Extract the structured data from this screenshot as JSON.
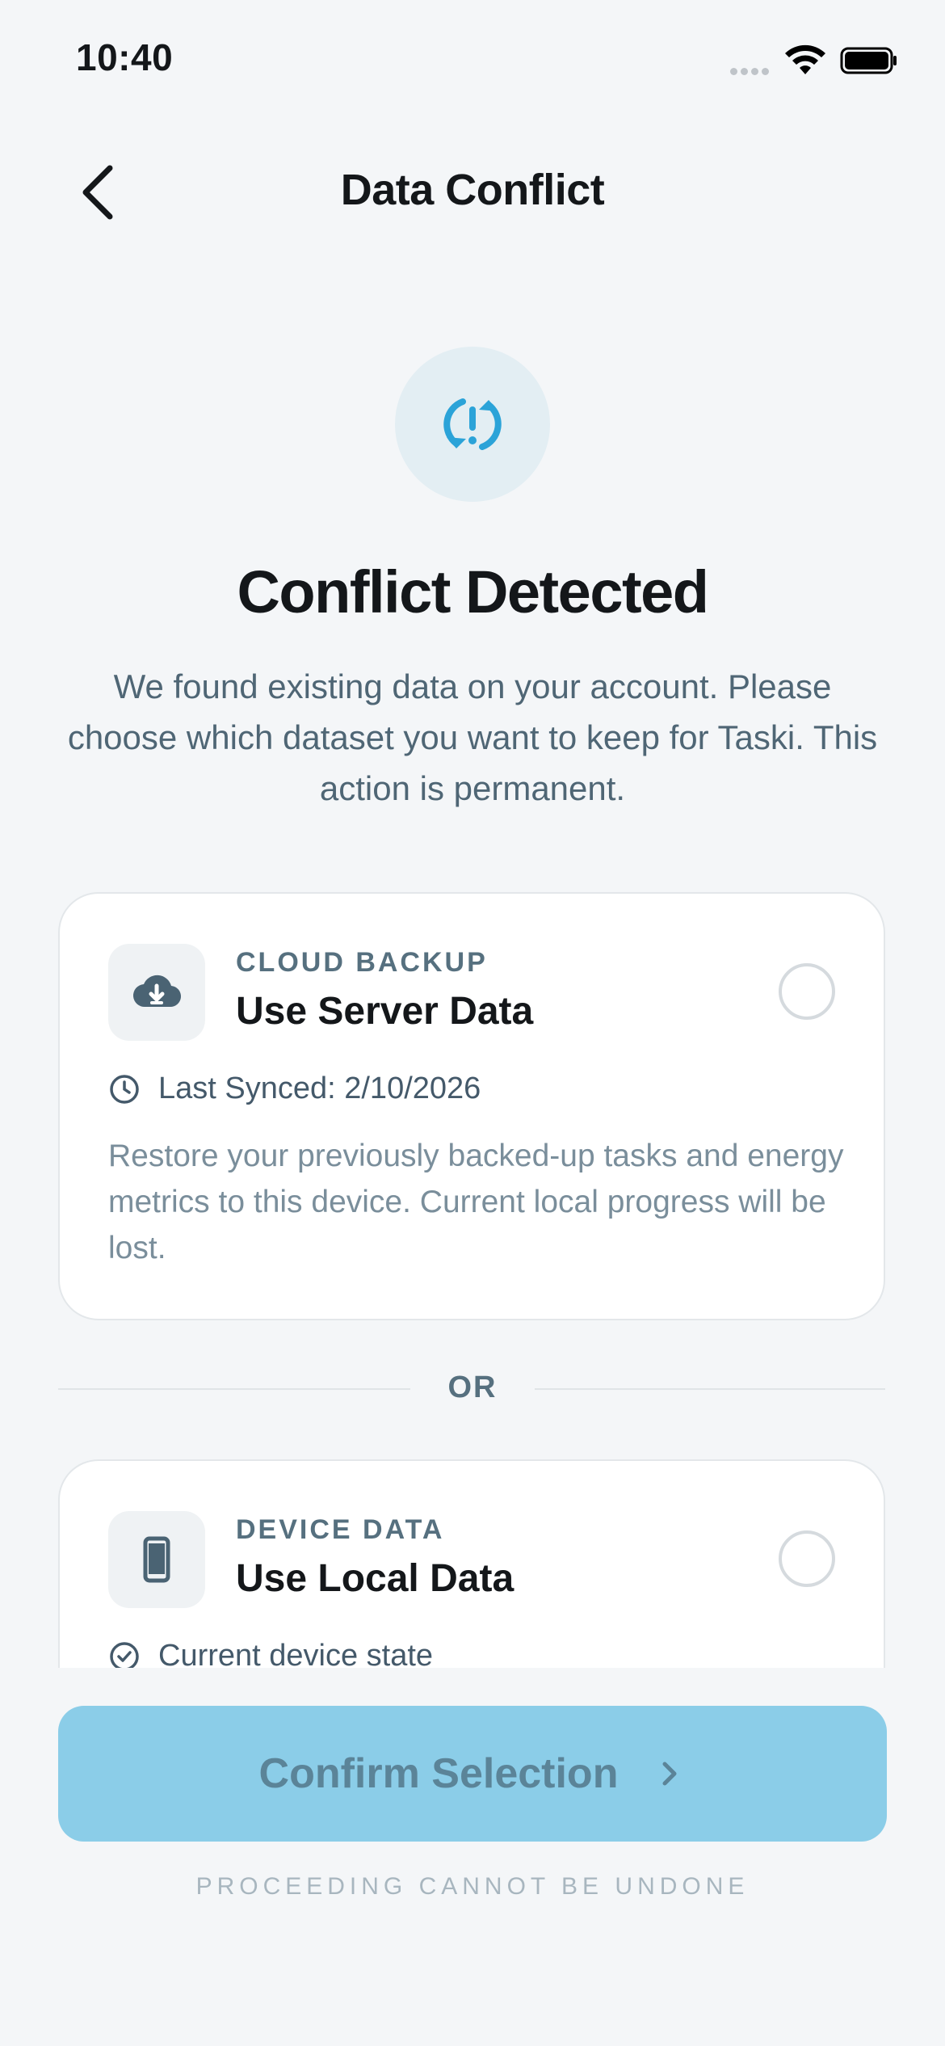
{
  "status_bar": {
    "time": "10:40"
  },
  "nav": {
    "title": "Data Conflict"
  },
  "hero": {
    "heading": "Conflict Detected",
    "description": "We found existing data on your account. Please choose which dataset you want to keep for Taski. This action is permanent."
  },
  "options": [
    {
      "kicker": "CLOUD BACKUP",
      "title": "Use Server Data",
      "meta": "Last Synced: 2/10/2026",
      "description": "Restore your previously backed-up tasks and energy metrics to this device. Current local progress will be lost."
    },
    {
      "kicker": "DEVICE DATA",
      "title": "Use Local Data",
      "meta": "Current device state"
    }
  ],
  "divider": {
    "label": "OR"
  },
  "footer": {
    "confirm_label": "Confirm Selection",
    "note": "PROCEEDING CANNOT BE UNDONE"
  },
  "colors": {
    "accent": "#2BA3D8",
    "button_bg": "#8BCDE8",
    "muted_text": "#4F6675",
    "background": "#F4F6F8"
  },
  "icons": {
    "back": "chevron-left-icon",
    "hero": "sync-alert-icon",
    "cloud": "cloud-download-icon",
    "device": "smartphone-icon",
    "clock": "clock-icon",
    "check": "check-circle-icon",
    "arrow": "chevron-right-icon"
  }
}
